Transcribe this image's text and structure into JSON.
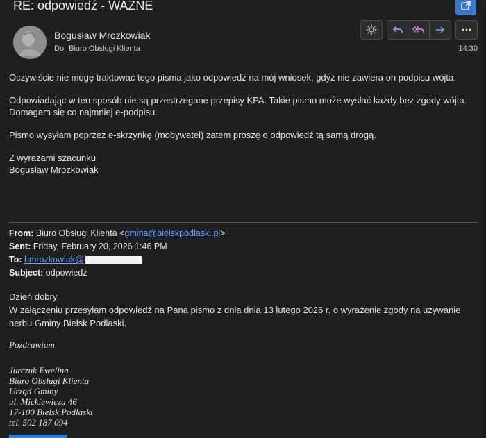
{
  "email": {
    "subject": "RE: odpowiedź - WAŻNE",
    "sender_name": "Bogusław Mrozkowiak",
    "to_label": "Do",
    "recipient": "Biuro Obsługi Klienta",
    "time": "14:30"
  },
  "toolbar": {
    "icons": [
      "brightness-icon",
      "reply-icon",
      "reply-all-icon",
      "forward-icon",
      "more-icon"
    ]
  },
  "body": {
    "p1": "Oczywiście nie mogę traktować tego pisma jako odpowiedź na mój wniosek, gdyż nie zawiera on podpisu wójta.",
    "p2_line1": "Odpowiadając w ten sposób nie są przestrzegane przepisy KPA. Takie pismo może wysłać każdy bez zgody wójta.",
    "p2_line2": "Domagam się co najmniej e-podpisu.",
    "p3": "Pismo wysyłam poprzez e-skrzynkę (mobywatel) zatem proszę o odpowiedź tą samą drogą.",
    "closing1": "Z wyrazami szacunku",
    "closing2": "Bogusław Mrozkowiak"
  },
  "quoted": {
    "from_label": "From:",
    "from_name": "Biuro Obsługi Klienta <",
    "from_email": "gmina@bielskpodlaski.pl",
    "from_close": ">",
    "sent_label": "Sent:",
    "sent_value": "Friday, February 20, 2026 1:46 PM",
    "to_label": "To:",
    "to_email": "bmrozkowiak@",
    "subject_label": "Subject:",
    "subject_value": "odpowiedź",
    "greeting": "Dzień dobry",
    "line1": "W załączeniu przesyłam odpowiedź na Pana pismo z dnia  dnia 13 lutego 2026 r. o wyrażenie zgody na używanie",
    "line2": "herbu Gminy Bielsk Podlaski."
  },
  "signature": {
    "regards": "Pozdrawiam",
    "name": "Jurczuk Ewelina",
    "dept": "Biuro Obsługi Klienta",
    "office": "Urząd Gminy",
    "street": "ul. Mickiewicza 46",
    "city": "17-100 Bielsk Podlaski",
    "phone": "tel. 502 187 094"
  },
  "colors": {
    "background": "#1f1f1f",
    "accent": "#3b78c9",
    "reply_purple": "#c792ea",
    "forward_blue": "#6aa7ff",
    "link": "#6aa7ff"
  }
}
